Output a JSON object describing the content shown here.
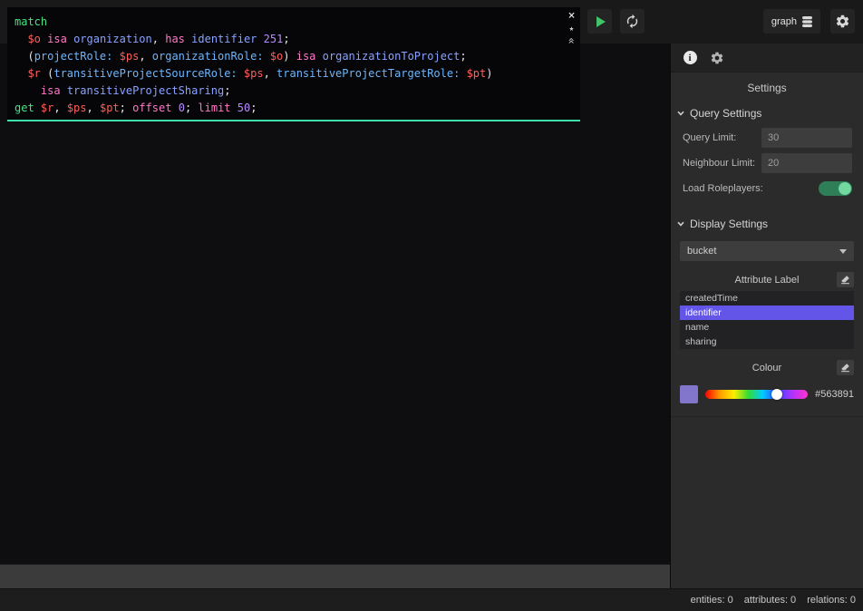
{
  "colors": {
    "selection": "#6355e8",
    "swatch": "#8276cc",
    "editor_underline": "#3fe0a8",
    "play_green": "#41c36a",
    "toggle_green": "#2e7e57"
  },
  "topbar": {
    "database_button": {
      "label": "graph"
    }
  },
  "editor": {
    "controls": {
      "close": "×",
      "favorite": "★",
      "collapse": "«"
    },
    "lines": [
      [
        [
          "k",
          "match"
        ]
      ],
      [
        [
          "p",
          "  "
        ],
        [
          "v",
          "$o"
        ],
        [
          "p",
          " "
        ],
        [
          "o",
          "isa"
        ],
        [
          "p",
          " "
        ],
        [
          "t",
          "organization"
        ],
        [
          "p",
          ", "
        ],
        [
          "o",
          "has"
        ],
        [
          "p",
          " "
        ],
        [
          "t",
          "identifier"
        ],
        [
          "p",
          " "
        ],
        [
          "n",
          "251"
        ],
        [
          "p",
          ";"
        ]
      ],
      [
        [
          "p",
          "  ("
        ],
        [
          "r",
          "projectRole:"
        ],
        [
          "p",
          " "
        ],
        [
          "v",
          "$ps"
        ],
        [
          "p",
          ", "
        ],
        [
          "r",
          "organizationRole:"
        ],
        [
          "p",
          " "
        ],
        [
          "v",
          "$o"
        ],
        [
          "p",
          ") "
        ],
        [
          "o",
          "isa"
        ],
        [
          "p",
          " "
        ],
        [
          "t",
          "organizationToProject"
        ],
        [
          "p",
          ";"
        ]
      ],
      [
        [
          "p",
          "  "
        ],
        [
          "v",
          "$r"
        ],
        [
          "p",
          " ("
        ],
        [
          "r",
          "transitiveProjectSourceRole:"
        ],
        [
          "p",
          " "
        ],
        [
          "v",
          "$ps"
        ],
        [
          "p",
          ", "
        ],
        [
          "r",
          "transitiveProjectTargetRole:"
        ],
        [
          "p",
          " "
        ],
        [
          "v",
          "$pt"
        ],
        [
          "p",
          ")"
        ]
      ],
      [
        [
          "p",
          "    "
        ],
        [
          "o",
          "isa"
        ],
        [
          "p",
          " "
        ],
        [
          "t",
          "transitiveProjectSharing"
        ],
        [
          "p",
          ";"
        ]
      ],
      [
        [
          "k",
          "get"
        ],
        [
          "p",
          " "
        ],
        [
          "v",
          "$r"
        ],
        [
          "p",
          ", "
        ],
        [
          "v",
          "$ps"
        ],
        [
          "p",
          ", "
        ],
        [
          "v",
          "$pt"
        ],
        [
          "p",
          "; "
        ],
        [
          "o",
          "offset"
        ],
        [
          "p",
          " "
        ],
        [
          "n",
          "0"
        ],
        [
          "p",
          "; "
        ],
        [
          "o",
          "limit"
        ],
        [
          "p",
          " "
        ],
        [
          "n",
          "50"
        ],
        [
          "p",
          ";"
        ]
      ]
    ]
  },
  "panel": {
    "title": "Settings",
    "query_settings": {
      "header": "Query Settings",
      "query_limit_label": "Query Limit:",
      "query_limit_value": "30",
      "neighbour_limit_label": "Neighbour Limit:",
      "neighbour_limit_value": "20",
      "load_roleplayers_label": "Load Roleplayers:",
      "load_roleplayers_on": true
    },
    "display_settings": {
      "header": "Display Settings",
      "type_dropdown_value": "bucket",
      "attribute_label": {
        "title": "Attribute Label",
        "options": [
          "createdTime",
          "identifier",
          "name",
          "sharing"
        ],
        "selected": "identifier"
      },
      "colour": {
        "title": "Colour",
        "hex": "#563891",
        "handle_percent": 70
      }
    }
  },
  "statusbar": {
    "entities": "entities: 0",
    "attributes": "attributes: 0",
    "relations": "relations: 0"
  }
}
